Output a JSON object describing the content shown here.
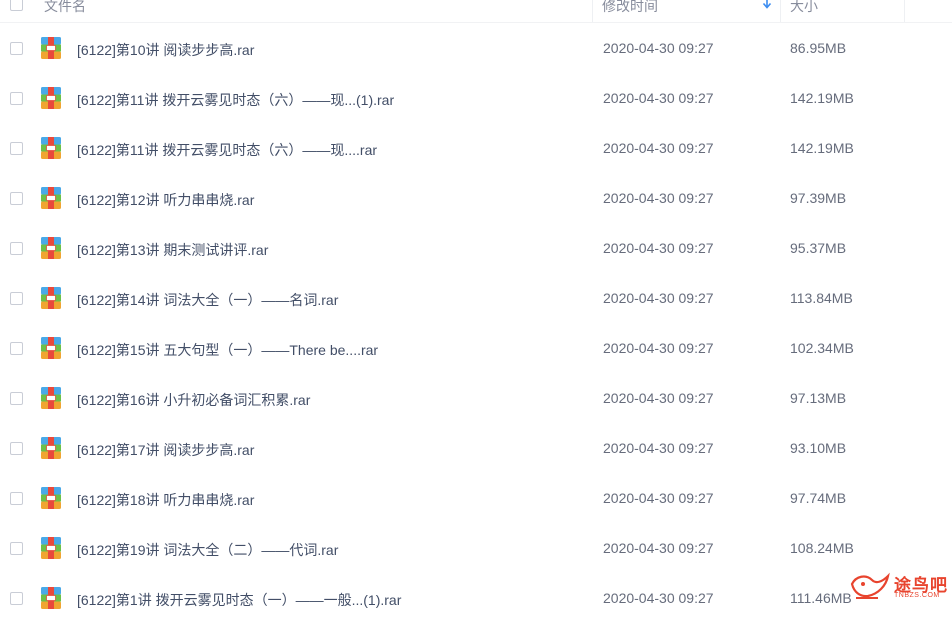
{
  "header": {
    "name_label": "文件名",
    "time_label": "修改时间",
    "size_label": "大小"
  },
  "colors": {
    "archive_top": "#4aa9e8",
    "archive_middle": "#6cc04a",
    "archive_bottom": "#f0a531",
    "archive_band": "#e84a3c",
    "sort_arrow": "#3b8cf0",
    "watermark": "#e8442e"
  },
  "files": [
    {
      "name": "[6122]第10讲 阅读步步高.rar",
      "time": "2020-04-30 09:27",
      "size": "86.95MB",
      "icon": "rar-archive-icon"
    },
    {
      "name": "[6122]第11讲 拨开云雾见时态（六）——现...(1).rar",
      "time": "2020-04-30 09:27",
      "size": "142.19MB",
      "icon": "rar-archive-icon"
    },
    {
      "name": "[6122]第11讲 拨开云雾见时态（六）——现....rar",
      "time": "2020-04-30 09:27",
      "size": "142.19MB",
      "icon": "rar-archive-icon"
    },
    {
      "name": "[6122]第12讲 听力串串烧.rar",
      "time": "2020-04-30 09:27",
      "size": "97.39MB",
      "icon": "rar-archive-icon"
    },
    {
      "name": "[6122]第13讲 期末测试讲评.rar",
      "time": "2020-04-30 09:27",
      "size": "95.37MB",
      "icon": "rar-archive-icon"
    },
    {
      "name": "[6122]第14讲 词法大全（一）——名词.rar",
      "time": "2020-04-30 09:27",
      "size": "113.84MB",
      "icon": "rar-archive-icon"
    },
    {
      "name": "[6122]第15讲 五大句型（一）——There be....rar",
      "time": "2020-04-30 09:27",
      "size": "102.34MB",
      "icon": "rar-archive-icon"
    },
    {
      "name": "[6122]第16讲 小升初必备词汇积累.rar",
      "time": "2020-04-30 09:27",
      "size": "97.13MB",
      "icon": "rar-archive-icon"
    },
    {
      "name": "[6122]第17讲 阅读步步高.rar",
      "time": "2020-04-30 09:27",
      "size": "93.10MB",
      "icon": "rar-archive-icon"
    },
    {
      "name": "[6122]第18讲 听力串串烧.rar",
      "time": "2020-04-30 09:27",
      "size": "97.74MB",
      "icon": "rar-archive-icon"
    },
    {
      "name": "[6122]第19讲 词法大全（二）——代词.rar",
      "time": "2020-04-30 09:27",
      "size": "108.24MB",
      "icon": "rar-archive-icon"
    },
    {
      "name": "[6122]第1讲 拨开云雾见时态（一）——一般...(1).rar",
      "time": "2020-04-30 09:27",
      "size": "111.46MB",
      "icon": "rar-archive-icon"
    }
  ],
  "watermark": {
    "text": "途鸟吧",
    "sub": "TNBZS.COM"
  }
}
